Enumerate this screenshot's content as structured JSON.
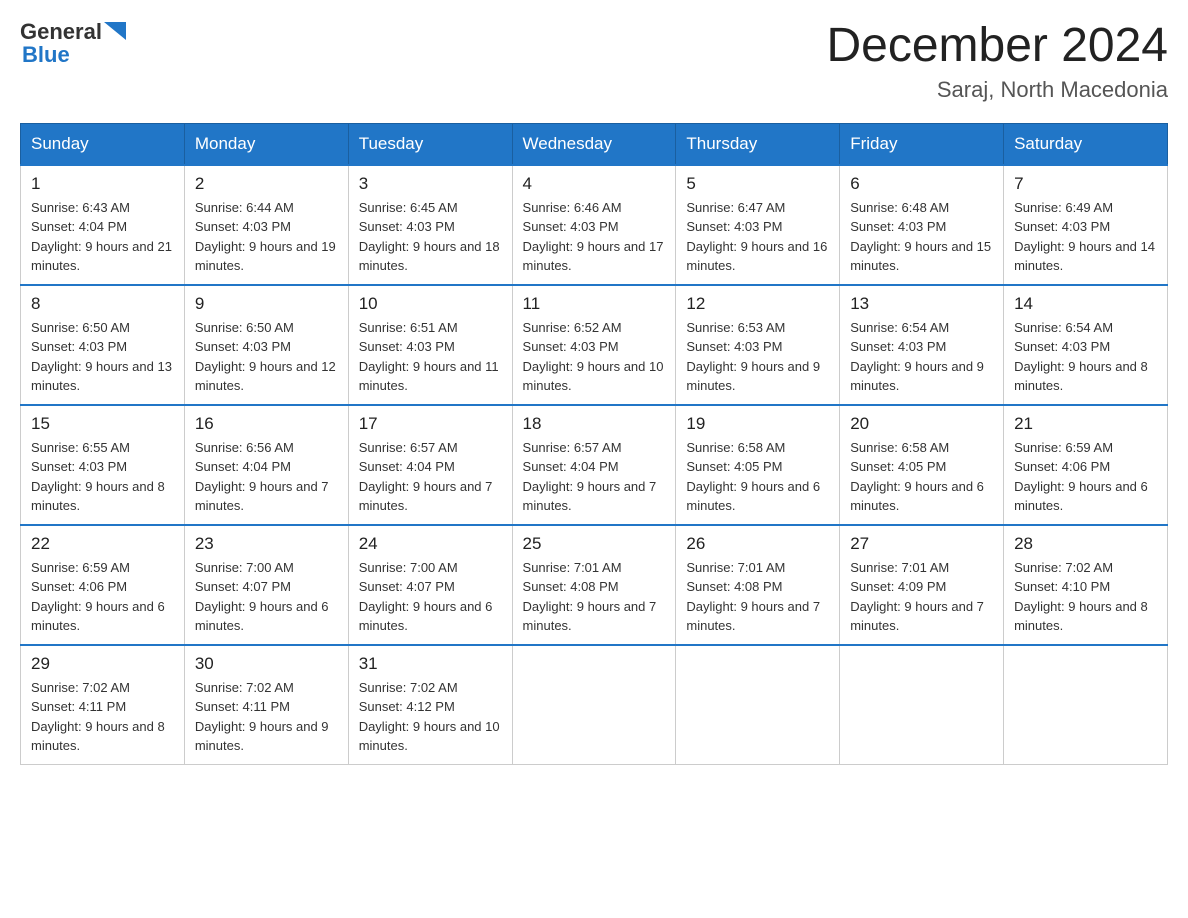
{
  "header": {
    "logo": {
      "general": "General",
      "blue": "Blue"
    },
    "title": "December 2024",
    "location": "Saraj, North Macedonia"
  },
  "calendar": {
    "days_of_week": [
      "Sunday",
      "Monday",
      "Tuesday",
      "Wednesday",
      "Thursday",
      "Friday",
      "Saturday"
    ],
    "weeks": [
      [
        {
          "day": "1",
          "sunrise": "6:43 AM",
          "sunset": "4:04 PM",
          "daylight": "9 hours and 21 minutes."
        },
        {
          "day": "2",
          "sunrise": "6:44 AM",
          "sunset": "4:03 PM",
          "daylight": "9 hours and 19 minutes."
        },
        {
          "day": "3",
          "sunrise": "6:45 AM",
          "sunset": "4:03 PM",
          "daylight": "9 hours and 18 minutes."
        },
        {
          "day": "4",
          "sunrise": "6:46 AM",
          "sunset": "4:03 PM",
          "daylight": "9 hours and 17 minutes."
        },
        {
          "day": "5",
          "sunrise": "6:47 AM",
          "sunset": "4:03 PM",
          "daylight": "9 hours and 16 minutes."
        },
        {
          "day": "6",
          "sunrise": "6:48 AM",
          "sunset": "4:03 PM",
          "daylight": "9 hours and 15 minutes."
        },
        {
          "day": "7",
          "sunrise": "6:49 AM",
          "sunset": "4:03 PM",
          "daylight": "9 hours and 14 minutes."
        }
      ],
      [
        {
          "day": "8",
          "sunrise": "6:50 AM",
          "sunset": "4:03 PM",
          "daylight": "9 hours and 13 minutes."
        },
        {
          "day": "9",
          "sunrise": "6:50 AM",
          "sunset": "4:03 PM",
          "daylight": "9 hours and 12 minutes."
        },
        {
          "day": "10",
          "sunrise": "6:51 AM",
          "sunset": "4:03 PM",
          "daylight": "9 hours and 11 minutes."
        },
        {
          "day": "11",
          "sunrise": "6:52 AM",
          "sunset": "4:03 PM",
          "daylight": "9 hours and 10 minutes."
        },
        {
          "day": "12",
          "sunrise": "6:53 AM",
          "sunset": "4:03 PM",
          "daylight": "9 hours and 9 minutes."
        },
        {
          "day": "13",
          "sunrise": "6:54 AM",
          "sunset": "4:03 PM",
          "daylight": "9 hours and 9 minutes."
        },
        {
          "day": "14",
          "sunrise": "6:54 AM",
          "sunset": "4:03 PM",
          "daylight": "9 hours and 8 minutes."
        }
      ],
      [
        {
          "day": "15",
          "sunrise": "6:55 AM",
          "sunset": "4:03 PM",
          "daylight": "9 hours and 8 minutes."
        },
        {
          "day": "16",
          "sunrise": "6:56 AM",
          "sunset": "4:04 PM",
          "daylight": "9 hours and 7 minutes."
        },
        {
          "day": "17",
          "sunrise": "6:57 AM",
          "sunset": "4:04 PM",
          "daylight": "9 hours and 7 minutes."
        },
        {
          "day": "18",
          "sunrise": "6:57 AM",
          "sunset": "4:04 PM",
          "daylight": "9 hours and 7 minutes."
        },
        {
          "day": "19",
          "sunrise": "6:58 AM",
          "sunset": "4:05 PM",
          "daylight": "9 hours and 6 minutes."
        },
        {
          "day": "20",
          "sunrise": "6:58 AM",
          "sunset": "4:05 PM",
          "daylight": "9 hours and 6 minutes."
        },
        {
          "day": "21",
          "sunrise": "6:59 AM",
          "sunset": "4:06 PM",
          "daylight": "9 hours and 6 minutes."
        }
      ],
      [
        {
          "day": "22",
          "sunrise": "6:59 AM",
          "sunset": "4:06 PM",
          "daylight": "9 hours and 6 minutes."
        },
        {
          "day": "23",
          "sunrise": "7:00 AM",
          "sunset": "4:07 PM",
          "daylight": "9 hours and 6 minutes."
        },
        {
          "day": "24",
          "sunrise": "7:00 AM",
          "sunset": "4:07 PM",
          "daylight": "9 hours and 6 minutes."
        },
        {
          "day": "25",
          "sunrise": "7:01 AM",
          "sunset": "4:08 PM",
          "daylight": "9 hours and 7 minutes."
        },
        {
          "day": "26",
          "sunrise": "7:01 AM",
          "sunset": "4:08 PM",
          "daylight": "9 hours and 7 minutes."
        },
        {
          "day": "27",
          "sunrise": "7:01 AM",
          "sunset": "4:09 PM",
          "daylight": "9 hours and 7 minutes."
        },
        {
          "day": "28",
          "sunrise": "7:02 AM",
          "sunset": "4:10 PM",
          "daylight": "9 hours and 8 minutes."
        }
      ],
      [
        {
          "day": "29",
          "sunrise": "7:02 AM",
          "sunset": "4:11 PM",
          "daylight": "9 hours and 8 minutes."
        },
        {
          "day": "30",
          "sunrise": "7:02 AM",
          "sunset": "4:11 PM",
          "daylight": "9 hours and 9 minutes."
        },
        {
          "day": "31",
          "sunrise": "7:02 AM",
          "sunset": "4:12 PM",
          "daylight": "9 hours and 10 minutes."
        },
        null,
        null,
        null,
        null
      ]
    ]
  }
}
